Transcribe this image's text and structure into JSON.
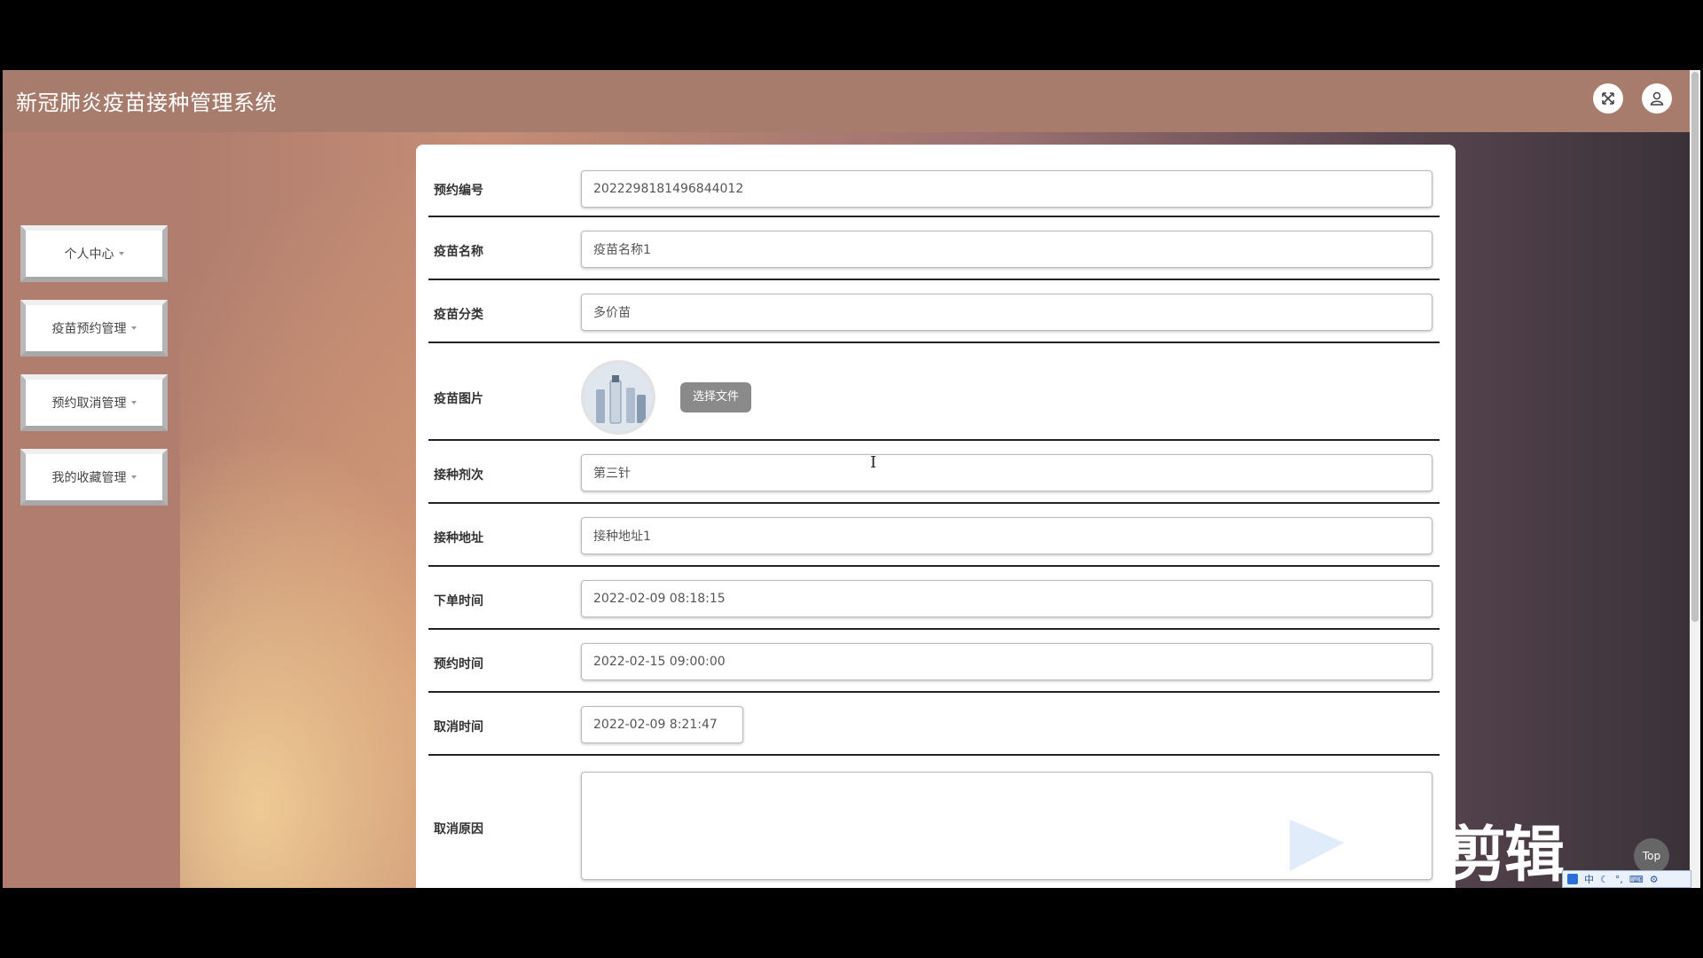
{
  "header": {
    "title": "新冠肺炎疫苗接种管理系统",
    "fullscreen_icon": "fullscreen-toggle-icon",
    "user_icon": "user-icon"
  },
  "sidebar": {
    "items": [
      {
        "label": "个人中心"
      },
      {
        "label": "疫苗预约管理"
      },
      {
        "label": "预约取消管理"
      },
      {
        "label": "我的收藏管理"
      }
    ]
  },
  "form": {
    "booking_no": {
      "label": "预约编号",
      "value": "2022298181496844012"
    },
    "vaccine_name": {
      "label": "疫苗名称",
      "value": "疫苗名称1"
    },
    "vaccine_category": {
      "label": "疫苗分类",
      "value": "多价苗"
    },
    "vaccine_image": {
      "label": "疫苗图片",
      "button": "选择文件"
    },
    "dose": {
      "label": "接种剂次",
      "value": "第三针"
    },
    "address": {
      "label": "接种地址",
      "value": "接种地址1"
    },
    "order_time": {
      "label": "下单时间",
      "value": "2022-02-09 08:18:15"
    },
    "appointment_time": {
      "label": "预约时间",
      "value": "2022-02-15 09:00:00"
    },
    "cancel_time": {
      "label": "取消时间",
      "value": "2022-02-09 8:21:47"
    },
    "cancel_reason": {
      "label": "取消原因",
      "value": ""
    }
  },
  "overlay": {
    "watermark": "剪辑",
    "top_button": "Top",
    "ime_text": "中"
  },
  "colors": {
    "header_bg": "#a87c6d",
    "sidebar_bg": "#b17d6e",
    "file_button": "#8a8a8a"
  }
}
